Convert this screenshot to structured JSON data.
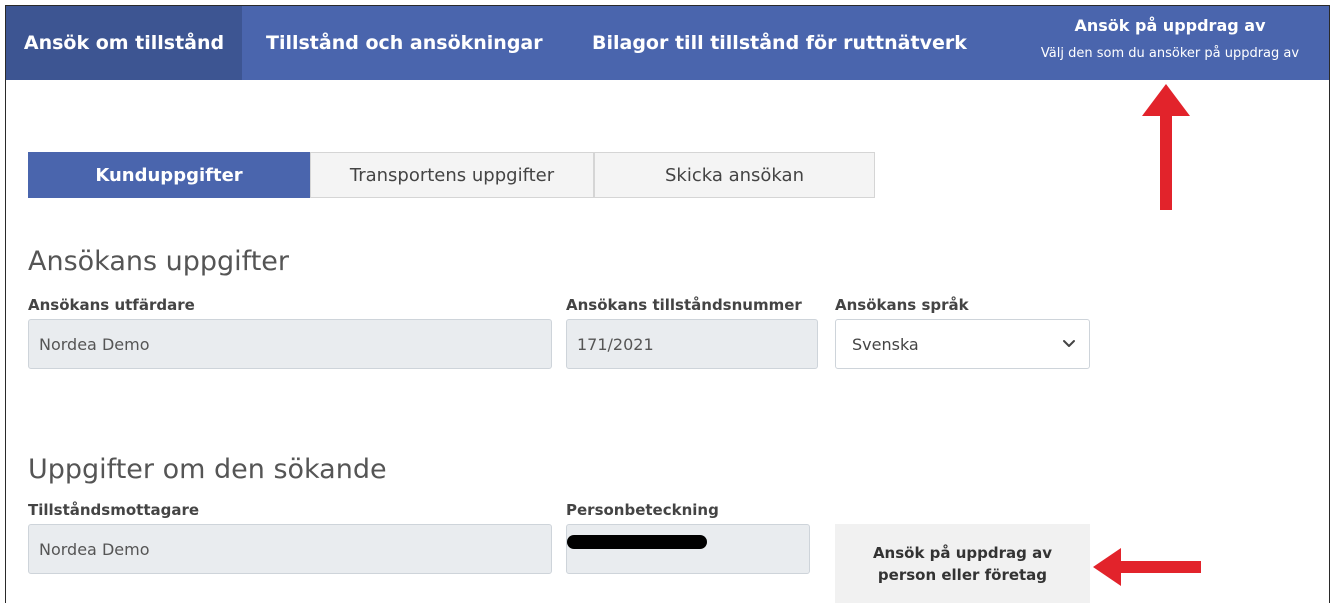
{
  "topnav": {
    "items": [
      {
        "label": "Ansök om tillstånd",
        "active": true
      },
      {
        "label": "Tillstånd och ansökningar",
        "active": false
      },
      {
        "label": "Bilagor till tillstånd för ruttnätverk",
        "active": false
      }
    ],
    "on_behalf": {
      "title": "Ansök på uppdrag av",
      "subtitle": "Välj den som du ansöker på uppdrag av"
    }
  },
  "tabs": [
    {
      "label": "Kunduppgifter",
      "active": true
    },
    {
      "label": "Transportens uppgifter",
      "active": false
    },
    {
      "label": "Skicka ansökan",
      "active": false
    }
  ],
  "application": {
    "title": "Ansökans uppgifter",
    "issuer_label": "Ansökans utfärdare",
    "issuer_value": "Nordea Demo",
    "permit_number_label": "Ansökans tillståndsnummer",
    "permit_number_value": "171/2021",
    "language_label": "Ansökans språk",
    "language_value": "Svenska"
  },
  "applicant": {
    "title": "Uppgifter om den sökande",
    "recipient_label": "Tillståndsmottagare",
    "recipient_value": "Nordea Demo",
    "id_label": "Personbeteckning",
    "id_value_redacted": true,
    "behalf_button_line1": "Ansök på uppdrag av",
    "behalf_button_line2": "person eller företag"
  },
  "colors": {
    "nav_bg": "#4a65ad",
    "nav_active_bg": "#3d5592",
    "annotation_arrow": "#e2232b"
  },
  "annotations": [
    {
      "type": "arrow",
      "direction": "up",
      "points_to": "Ansök på uppdrag av (top navigation)"
    },
    {
      "type": "arrow",
      "direction": "left",
      "points_to": "Ansök på uppdrag av person eller företag"
    }
  ]
}
